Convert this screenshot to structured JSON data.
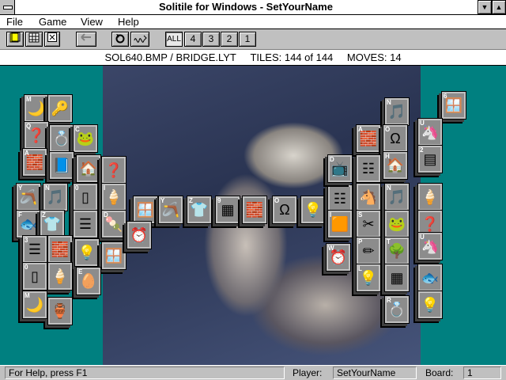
{
  "window": {
    "title": "Solitile for Windows - SetYourName",
    "minimize_glyph": "▼",
    "maximize_glyph": "▲"
  },
  "menu": [
    "File",
    "Game",
    "View",
    "Help"
  ],
  "toolbar": {
    "filter_buttons": [
      "ALL",
      "4",
      "3",
      "2",
      "1"
    ]
  },
  "infobar": {
    "files": "SOL640.BMP / BRIDGE.LYT",
    "tiles": "TILES: 144 of 144",
    "moves": "MOVES: 14"
  },
  "tiles": [
    {
      "glyph": "🌙",
      "letter": "M"
    },
    {
      "glyph": "🔑",
      "letter": ""
    },
    {
      "glyph": "❓",
      "letter": "Q"
    },
    {
      "glyph": "💍",
      "letter": ""
    },
    {
      "glyph": "🐸",
      "letter": "C"
    },
    {
      "glyph": "🧱",
      "letter": "A"
    },
    {
      "glyph": "📘",
      "letter": ""
    },
    {
      "glyph": "🏠",
      "letter": ""
    },
    {
      "glyph": "❓",
      "letter": ""
    },
    {
      "glyph": "🪃",
      "letter": "Y"
    },
    {
      "glyph": "🎵",
      "letter": "N"
    },
    {
      "glyph": "▯",
      "letter": "0"
    },
    {
      "glyph": "🍦",
      "letter": "I"
    },
    {
      "glyph": "🐟",
      "letter": "F"
    },
    {
      "glyph": "👕",
      "letter": "Z"
    },
    {
      "glyph": "☰",
      "letter": ""
    },
    {
      "glyph": "🍡",
      "letter": "D"
    },
    {
      "glyph": "🧱",
      "letter": ""
    },
    {
      "glyph": "💡",
      "letter": ""
    },
    {
      "glyph": "🪟",
      "letter": ""
    },
    {
      "glyph": "☰",
      "letter": "3"
    },
    {
      "glyph": "🍦",
      "letter": ""
    },
    {
      "glyph": "🥚",
      "letter": "E"
    },
    {
      "glyph": "▯",
      "letter": "0"
    },
    {
      "glyph": "🏺",
      "letter": ""
    },
    {
      "glyph": "🌙",
      "letter": "M"
    },
    {
      "glyph": "🪟",
      "letter": ""
    },
    {
      "glyph": "🪃",
      "letter": "Y"
    },
    {
      "glyph": "👕",
      "letter": "Z"
    },
    {
      "glyph": "▦",
      "letter": "9"
    },
    {
      "glyph": "🧱",
      "letter": ""
    },
    {
      "glyph": "Ω",
      "letter": "O"
    },
    {
      "glyph": "💡",
      "letter": ""
    },
    {
      "glyph": "⏰",
      "letter": ""
    },
    {
      "glyph": "☷",
      "letter": ""
    },
    {
      "glyph": "🎵",
      "letter": "N"
    },
    {
      "glyph": "🪟",
      "letter": "6"
    },
    {
      "glyph": "🧱",
      "letter": "A"
    },
    {
      "glyph": "Ω",
      "letter": "O"
    },
    {
      "glyph": "🦄",
      "letter": "U"
    },
    {
      "glyph": "🏠",
      "letter": "H"
    },
    {
      "glyph": "▤",
      "letter": "2"
    },
    {
      "glyph": "📺",
      "letter": "D"
    },
    {
      "glyph": "☷",
      "letter": ""
    },
    {
      "glyph": "🐴",
      "letter": ""
    },
    {
      "glyph": "🎵",
      "letter": "N"
    },
    {
      "glyph": "🍦",
      "letter": ""
    },
    {
      "glyph": "🟧",
      "letter": "I"
    },
    {
      "glyph": "✂",
      "letter": "S"
    },
    {
      "glyph": "🐸",
      "letter": ""
    },
    {
      "glyph": "❓",
      "letter": ""
    },
    {
      "glyph": "⏰",
      "letter": "W"
    },
    {
      "glyph": "✏",
      "letter": "P"
    },
    {
      "glyph": "🌳",
      "letter": "T"
    },
    {
      "glyph": "🦄",
      "letter": "U"
    },
    {
      "glyph": "💡",
      "letter": "L"
    },
    {
      "glyph": "▦",
      "letter": ""
    },
    {
      "glyph": "🐟",
      "letter": ""
    },
    {
      "glyph": "💍",
      "letter": "R"
    },
    {
      "glyph": "💡",
      "letter": ""
    }
  ],
  "status": {
    "help": "For Help, press F1",
    "player_label": "Player:",
    "player": "SetYourName",
    "board_label": "Board:",
    "board": "1"
  }
}
